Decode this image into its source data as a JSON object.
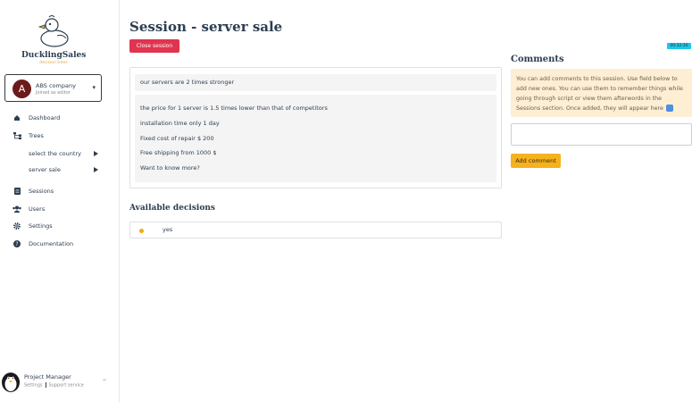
{
  "sidebar": {
    "logo": {
      "name": "DucklingSales",
      "tagline": "decision trees"
    },
    "company": {
      "initial": "A",
      "name": "ABS company",
      "role": "Joined as editor"
    },
    "nav": {
      "dashboard": "Dashboard",
      "trees": "Trees",
      "sub": [
        "select the country",
        "server sale"
      ],
      "sessions": "Sessions",
      "users": "Users",
      "settings": "Settings",
      "documentation": "Documentation"
    },
    "user": {
      "name": "Project Manager",
      "settings": "Settings",
      "support": "Support service",
      "logout_icon": "logout-icon"
    }
  },
  "main": {
    "title": "Session - server sale",
    "close_label": "Close session",
    "timer": "00:32:26",
    "script": {
      "first_line": "our servers are 2 times stronger",
      "lines": [
        "the price for 1 server is 1.5 times lower than that of competitors",
        "installation time only 1 day",
        "Fixed cost of repair $ 200",
        "Free shipping from 1000 $",
        "Want to know more?"
      ]
    },
    "decisions": {
      "title": "Available decisions",
      "items": [
        "yes"
      ]
    }
  },
  "comments": {
    "title": "Comments",
    "note": "You can add comments to this session. Use field below to add new ones. You can use them to remember things while going through script or view them afterwords in the Sessions section. Once added, they will appear here",
    "placeholder": "",
    "button": "Add comment"
  },
  "colors": {
    "danger": "#e0344f",
    "accent": "#f5b21f",
    "timer": "#1ec7e8",
    "note_bg": "#fdeed4",
    "text": "#2c3e50"
  }
}
